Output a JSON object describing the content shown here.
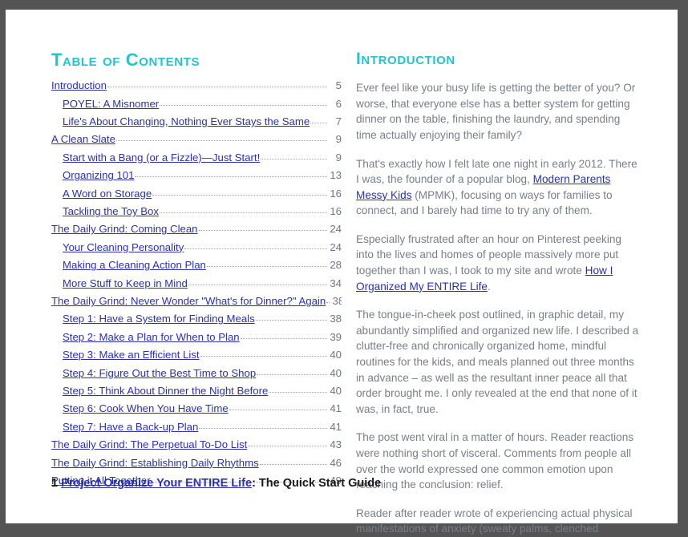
{
  "document": {
    "page_background": "#ffffff",
    "canvas_background": "#545454",
    "accent_color": "#23C4CB",
    "link_color": "#2B30B4",
    "body_text_color": "#787f88"
  },
  "toc": {
    "heading": "Table of Contents",
    "entries": [
      {
        "level": 1,
        "title": "Introduction",
        "page": "5"
      },
      {
        "level": 2,
        "title": "POYEL: A Misnomer",
        "page": "6"
      },
      {
        "level": 2,
        "title": "Life's About Changing, Nothing Ever Stays the Same",
        "page": "7"
      },
      {
        "level": 1,
        "title": "A Clean Slate",
        "page": "9"
      },
      {
        "level": 2,
        "title": "Start with a Bang (or a Fizzle)—Just Start!",
        "page": "9"
      },
      {
        "level": 2,
        "title": "Organizing 101 ",
        "page": "13"
      },
      {
        "level": 2,
        "title": "A Word on Storage",
        "page": "16"
      },
      {
        "level": 2,
        "title": "Tackling the Toy Box",
        "page": "16"
      },
      {
        "level": 1,
        "title": "The Daily Grind: Coming Clean",
        "page": "24"
      },
      {
        "level": 2,
        "title": "Your Cleaning Personality",
        "page": "24"
      },
      {
        "level": 2,
        "title": "Making a Cleaning Action Plan",
        "page": "28"
      },
      {
        "level": 2,
        "title": "More Stuff to Keep in Mind",
        "page": "34"
      },
      {
        "level": 1,
        "title": "The Daily Grind: Never Wonder \"What's for Dinner?\" Again",
        "page": "38"
      },
      {
        "level": 2,
        "title": "Step 1: Have a System for Finding Meals",
        "page": "38"
      },
      {
        "level": 2,
        "title": "Step 2: Make a Plan for When to Plan",
        "page": "39"
      },
      {
        "level": 2,
        "title": "Step 3: Make an Efficient List",
        "page": "40"
      },
      {
        "level": 2,
        "title": "Step 4: Figure Out the Best Time to Shop",
        "page": "40"
      },
      {
        "level": 2,
        "title": "Step 5: Think About Dinner the Night Before",
        "page": "40"
      },
      {
        "level": 2,
        "title": "Step 6: Cook When You Have Time",
        "page": "41"
      },
      {
        "level": 2,
        "title": "Step 7: Have a Back-up Plan",
        "page": "41"
      },
      {
        "level": 1,
        "title": "The Daily Grind: The Perpetual To-Do List",
        "page": "43"
      },
      {
        "level": 1,
        "title": "The Daily Grind: Establishing Daily Rhythms ",
        "page": "46"
      },
      {
        "level": 1,
        "title": "Putting it All Together ",
        "page": "49"
      }
    ]
  },
  "introduction": {
    "heading": "Introduction",
    "paragraphs": [
      {
        "runs": [
          {
            "type": "text",
            "text": "Ever feel like your busy life is getting the better of you? Or worse, that everyone else has a better system for getting dinner on the table, finishing the laundry, and spending time actually enjoying their family?"
          }
        ]
      },
      {
        "runs": [
          {
            "type": "text",
            "text": "That's exactly how I felt late one night in early 2012. There I was, the founder of a popular blog, "
          },
          {
            "type": "link",
            "text": "Modern Parents Messy Kids"
          },
          {
            "type": "text",
            "text": " (MPMK), focusing on ways for families to connect, and I barely had time to try any of them."
          }
        ]
      },
      {
        "runs": [
          {
            "type": "text",
            "text": "Especially frustrated after an hour on Pinterest peeking into the lives and homes of people massively more put together than I was, I took to my site and wrote "
          },
          {
            "type": "link",
            "text": "How I Organized My ENTIRE Life"
          },
          {
            "type": "text",
            "text": "."
          }
        ]
      },
      {
        "runs": [
          {
            "type": "text",
            "text": "The tongue-in-cheek post outlined, in graphic detail, my abundantly simplified and organized new life. I described a clutter-free and chronically organized home, mindful routines for the kids, and meals planned out three months in advance – as well as the resultant inner peace all that order brought me. I only revealed at the end that none of it was, in fact, true."
          }
        ]
      },
      {
        "runs": [
          {
            "type": "text",
            "text": "The post went viral in a matter of hours. Reader reactions were nothing short of visceral. Comments from people all over the world expressed one common emotion upon reaching the conclusion: relief."
          }
        ]
      },
      {
        "runs": [
          {
            "type": "text",
            "text": "Reader after reader wrote of experiencing actual physical manifestations of anxiety (sweaty palms, clenched"
          }
        ]
      }
    ]
  },
  "footer": {
    "page_number": "1",
    "link_text": "Project Organize Your ENTIRE Life",
    "suffix": ": The Quick Start Guide"
  }
}
